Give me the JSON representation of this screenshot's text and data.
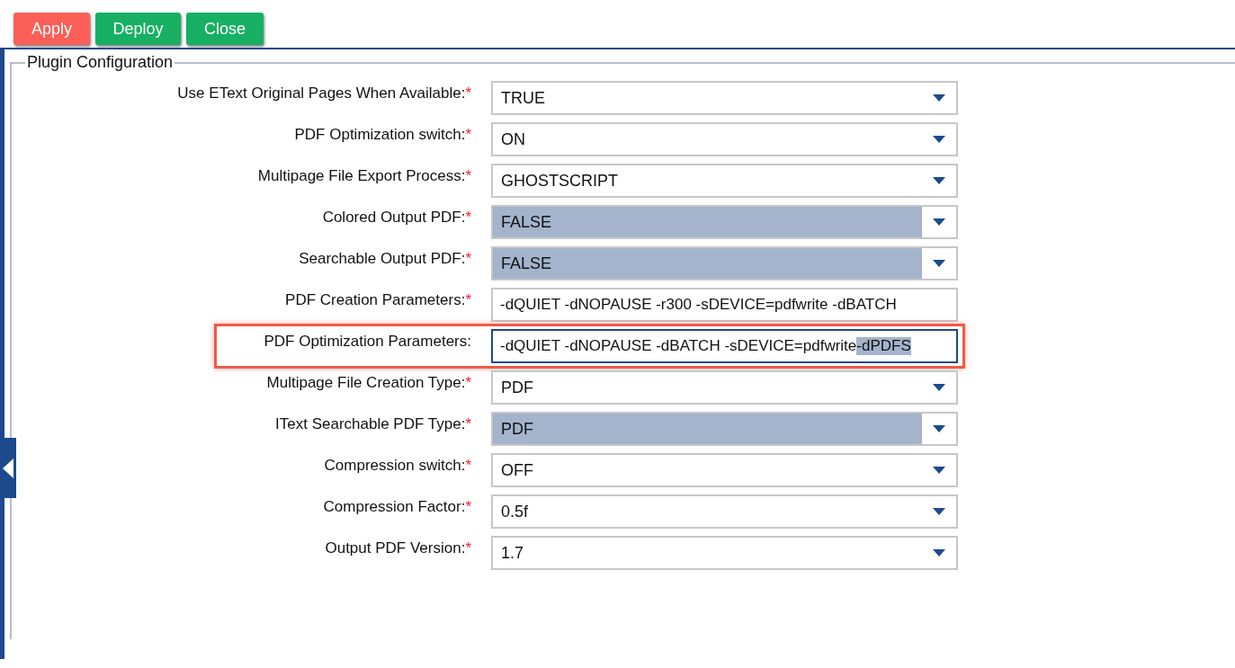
{
  "toolbar": [
    {
      "label": "Apply",
      "kind": "danger"
    },
    {
      "label": "Deploy",
      "kind": "success"
    },
    {
      "label": "Close",
      "kind": "success"
    }
  ],
  "panel": {
    "legend": "Plugin Configuration",
    "fields": [
      {
        "label": "Use EText Original Pages When Available:",
        "required_mark": "*",
        "kind": "select",
        "value": "TRUE",
        "highlighted": false,
        "focused": false
      },
      {
        "label": "PDF Optimization switch:",
        "required_mark": "*",
        "kind": "select",
        "value": "ON",
        "highlighted": false,
        "focused": false
      },
      {
        "label": "Multipage File Export Process:",
        "required_mark": "*",
        "kind": "select",
        "value": "GHOSTSCRIPT",
        "highlighted": false,
        "focused": false
      },
      {
        "label": "Colored Output PDF:",
        "required_mark": "*",
        "kind": "select",
        "value": "FALSE",
        "highlighted": true,
        "focused": false
      },
      {
        "label": "Searchable Output PDF:",
        "required_mark": "*",
        "kind": "select",
        "value": "FALSE",
        "highlighted": true,
        "focused": false
      },
      {
        "label": "PDF Creation Parameters:",
        "required_mark": "*",
        "kind": "text",
        "value": "-dQUIET -dNOPAUSE -r300 -sDEVICE=pdfwrite -dBATCH",
        "focused": false
      },
      {
        "label": "PDF Optimization Parameters:",
        "kind": "text",
        "value": "-dQUIET -dNOPAUSE -dBATCH -sDEVICE=pdfwrite",
        "selection": "-dPDFS",
        "focused": true
      },
      {
        "label": "Multipage File Creation Type:",
        "required_mark": "*",
        "kind": "select",
        "value": "PDF",
        "highlighted": false,
        "focused": false
      },
      {
        "label": "IText Searchable PDF Type:",
        "required_mark": "*",
        "kind": "select",
        "value": "PDF",
        "highlighted": true,
        "focused": false
      },
      {
        "label": "Compression switch:",
        "required_mark": "*",
        "kind": "select",
        "value": "OFF",
        "highlighted": false,
        "focused": false
      },
      {
        "label": "Compression Factor:",
        "required_mark": "*",
        "kind": "select",
        "value": "0.5f",
        "highlighted": false,
        "focused": false
      },
      {
        "label": "Output PDF Version:",
        "required_mark": "*",
        "kind": "select",
        "value": "1.7",
        "highlighted": false,
        "focused": false
      }
    ]
  }
}
